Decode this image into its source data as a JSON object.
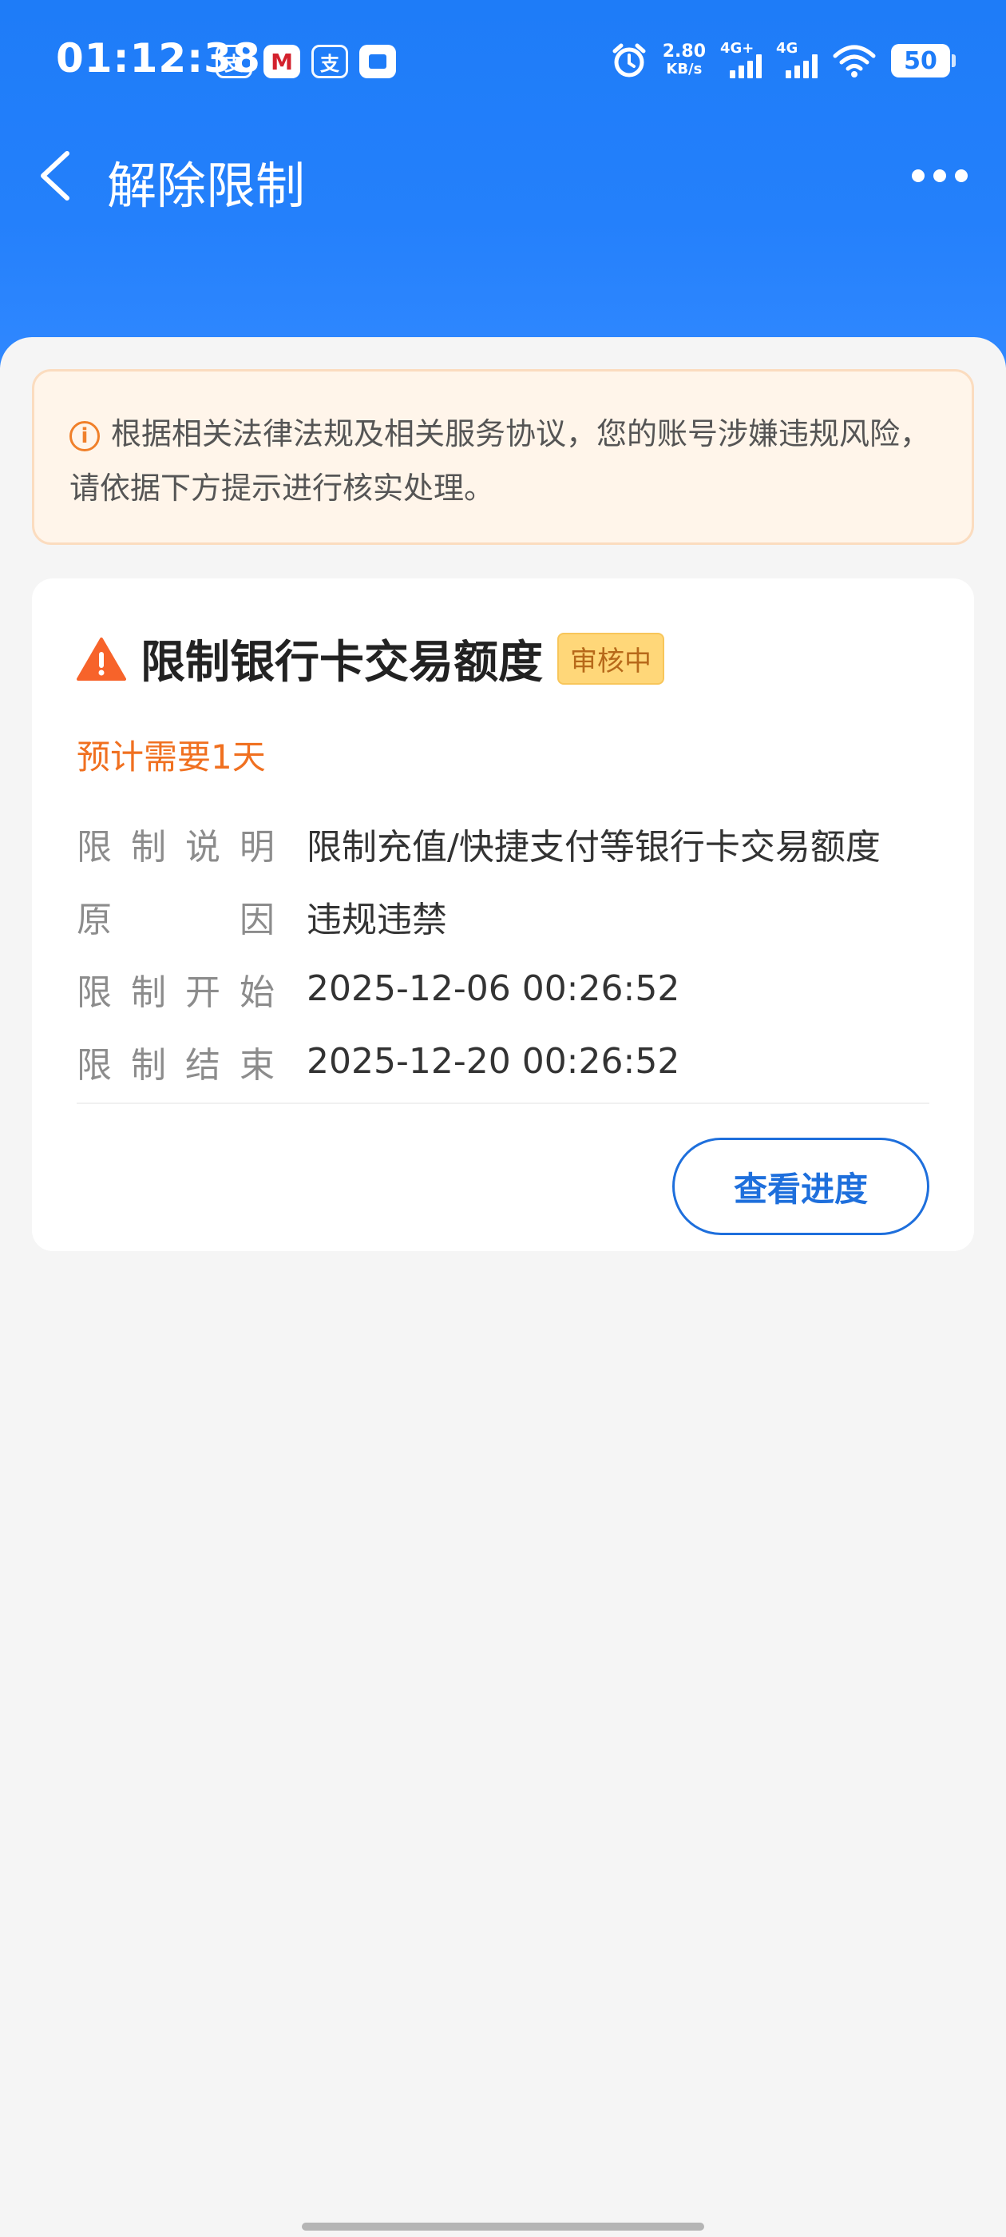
{
  "status_bar": {
    "time": "01:12:38",
    "app_icons": [
      {
        "name": "alipay-icon",
        "glyph": "支"
      },
      {
        "name": "cmb-bank-icon",
        "glyph": "M"
      },
      {
        "name": "alipay-icon-2",
        "glyph": "支"
      },
      {
        "name": "square-app-icon",
        "glyph": ""
      }
    ],
    "net_speed_value": "2.80",
    "net_speed_unit": "KB/s",
    "signal_1_tag": "4G+",
    "signal_2_tag": "4G",
    "battery": "50"
  },
  "nav": {
    "title": "解除限制"
  },
  "notice": {
    "text": "根据相关法律法规及相关服务协议，您的账号涉嫌违规风险，请依据下方提示进行核实处理。"
  },
  "card": {
    "title": "限制银行卡交易额度",
    "badge": "审核中",
    "estimate": "预计需要1天",
    "rows": [
      {
        "label_chars": [
          "限",
          "制",
          "说",
          "明"
        ],
        "value": "限制充值/快捷支付等银行卡交易额度"
      },
      {
        "label_chars": [
          "原",
          "因"
        ],
        "value": "违规违禁"
      },
      {
        "label_chars": [
          "限",
          "制",
          "开",
          "始"
        ],
        "value": "2025-12-06 00:26:52"
      },
      {
        "label_chars": [
          "限",
          "制",
          "结",
          "束"
        ],
        "value": "2025-12-20 00:26:52"
      }
    ],
    "button_label": "查看进度"
  },
  "colors": {
    "brand_blue": "#1e7cf8",
    "warning_orange": "#f07020",
    "badge_bg": "#ffd779"
  }
}
